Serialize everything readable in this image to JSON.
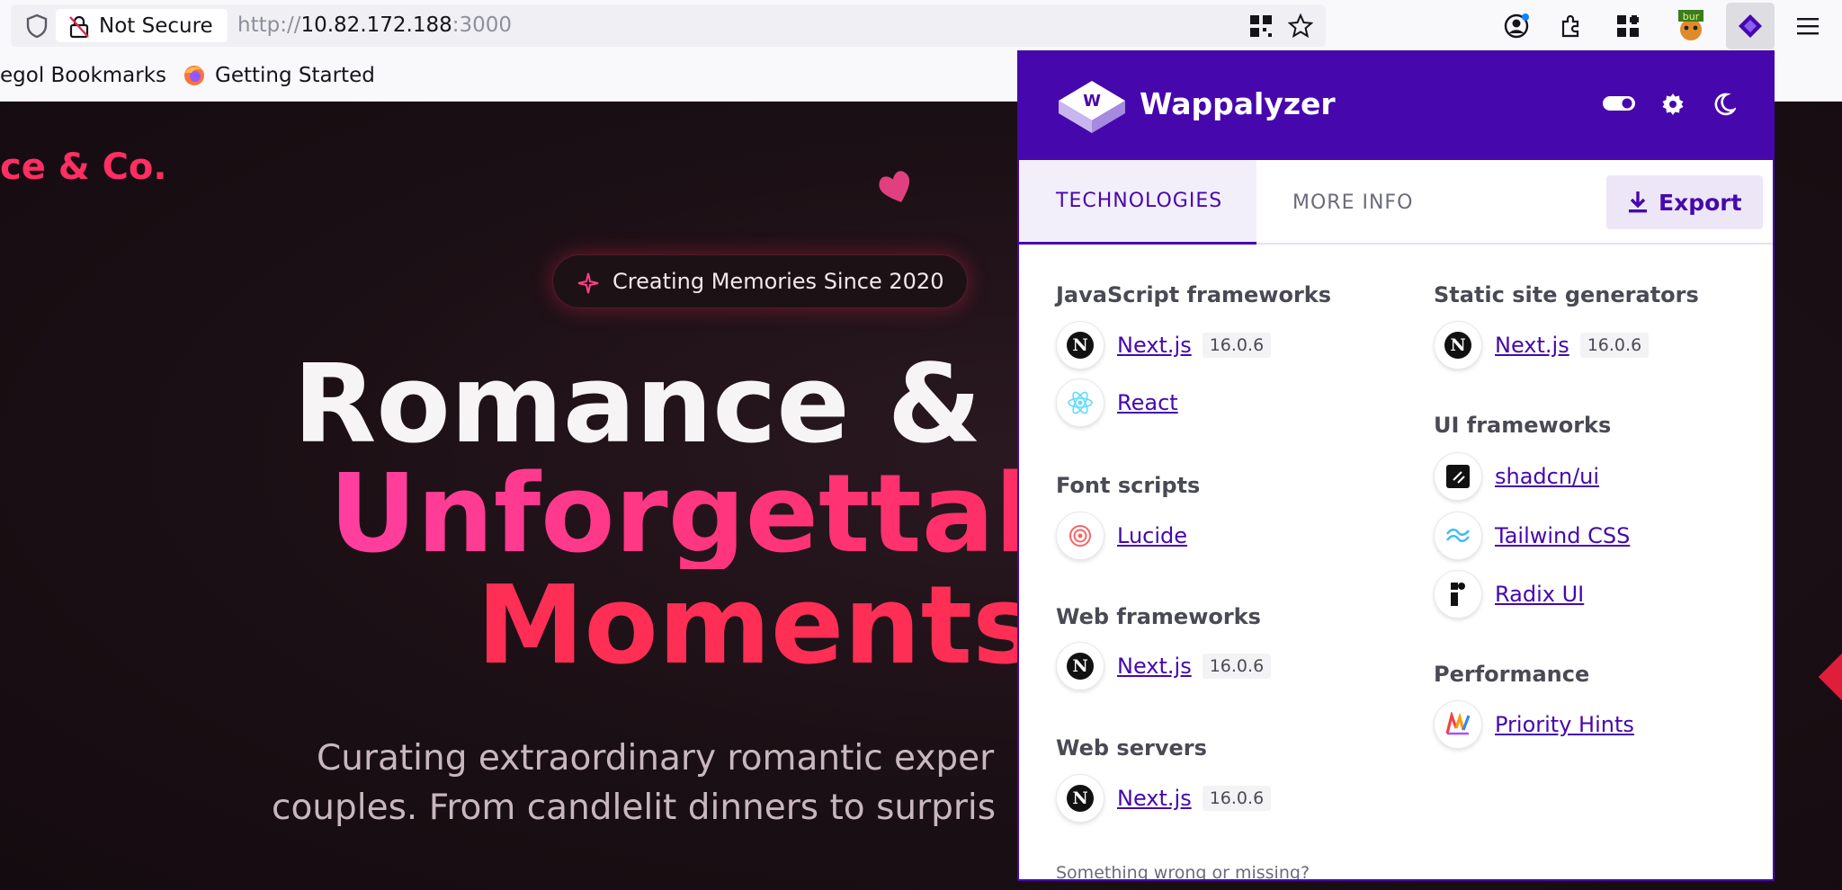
{
  "browser": {
    "security_label": "Not Secure",
    "url_scheme": "http://",
    "url_host": "10.82.172.188",
    "url_port": ":3000",
    "bookmarks": [
      "egol Bookmarks",
      "Getting Started"
    ],
    "extension_badge": "bur"
  },
  "page": {
    "brand": "ce & Co.",
    "pill": "Creating Memories Since 2020",
    "hero_line1": "Romance &",
    "hero_line2": "Unforgettal",
    "hero_line3": "Moments",
    "sub_line1": "Curating extraordinary romantic exper",
    "sub_line2": "couples. From candlelit dinners to surpris"
  },
  "wappalyzer": {
    "title": "Wappalyzer",
    "tabs": [
      "TECHNOLOGIES",
      "MORE INFO"
    ],
    "export_label": "Export",
    "left": [
      {
        "category": "JavaScript frameworks",
        "items": [
          {
            "name": "Next.js",
            "version": "16.0.6",
            "icon": "nextjs-icon"
          },
          {
            "name": "React",
            "version": "",
            "icon": "react-icon"
          }
        ]
      },
      {
        "category": "Font scripts",
        "items": [
          {
            "name": "Lucide",
            "version": "",
            "icon": "lucide-icon"
          }
        ]
      },
      {
        "category": "Web frameworks",
        "items": [
          {
            "name": "Next.js",
            "version": "16.0.6",
            "icon": "nextjs-icon"
          }
        ]
      },
      {
        "category": "Web servers",
        "items": [
          {
            "name": "Next.js",
            "version": "16.0.6",
            "icon": "nextjs-icon"
          }
        ]
      }
    ],
    "right": [
      {
        "category": "Static site generators",
        "items": [
          {
            "name": "Next.js",
            "version": "16.0.6",
            "icon": "nextjs-icon"
          }
        ]
      },
      {
        "category": "UI frameworks",
        "items": [
          {
            "name": "shadcn/ui",
            "version": "",
            "icon": "shadcn-icon"
          },
          {
            "name": "Tailwind CSS",
            "version": "",
            "icon": "tailwind-icon"
          },
          {
            "name": "Radix UI",
            "version": "",
            "icon": "radix-icon"
          }
        ]
      },
      {
        "category": "Performance",
        "items": [
          {
            "name": "Priority Hints",
            "version": "",
            "icon": "priority-hints-icon"
          }
        ]
      }
    ],
    "footer": "Something wrong or missing?"
  },
  "colors": {
    "wappalyzer_purple": "#4608ad",
    "brand_pink": "#ff2e63"
  }
}
